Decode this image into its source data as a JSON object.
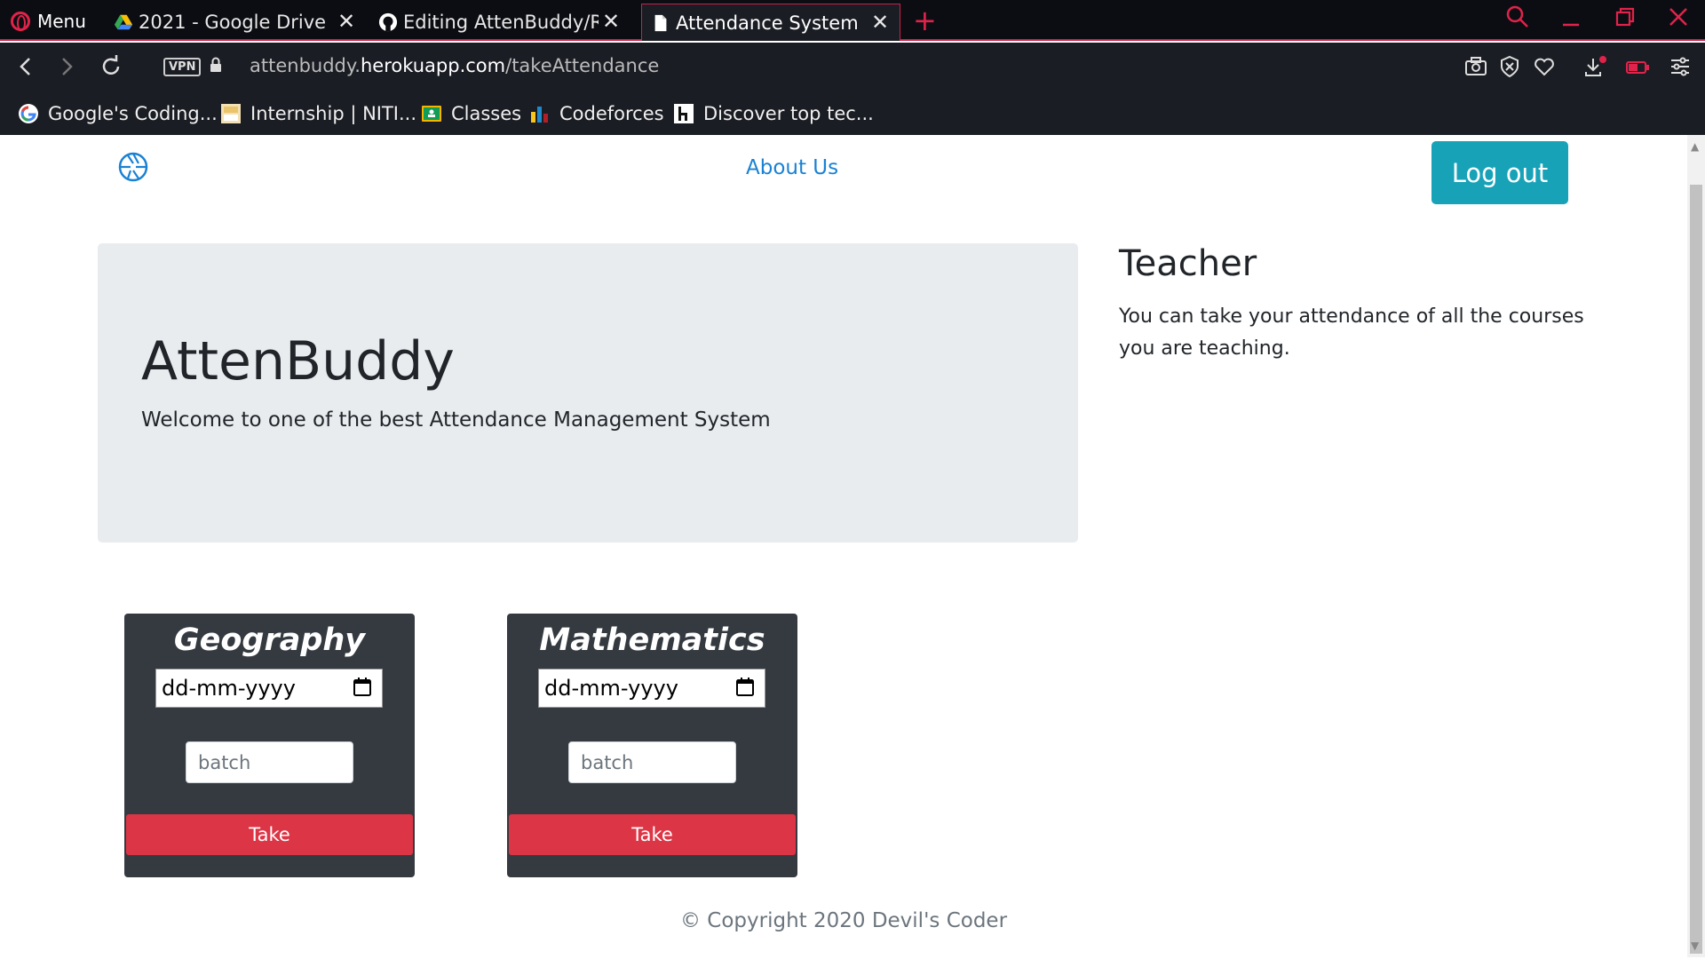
{
  "browser": {
    "menu_label": "Menu",
    "tabs": [
      {
        "title": "2021 - Google Drive"
      },
      {
        "title": "Editing AttenBuddy/README"
      },
      {
        "title": "Attendance System"
      }
    ],
    "vpn_label": "VPN",
    "url_host_prefix": "attenbuddy.",
    "url_host_main": "herokuapp.com",
    "url_path": "/takeAttendance",
    "bookmarks": [
      {
        "label": "Google's Coding..."
      },
      {
        "label": "Internship | NITI..."
      },
      {
        "label": "Classes"
      },
      {
        "label": "Codeforces"
      },
      {
        "label": "Discover top tec..."
      }
    ]
  },
  "nav": {
    "about_label": "About Us",
    "logout_label": "Log out"
  },
  "jumbotron": {
    "title": "AttenBuddy",
    "subtitle": "Welcome to one of the best Attendance Management System"
  },
  "teacher": {
    "title": "Teacher",
    "description": "You can take your attendance of all the courses you are teaching."
  },
  "courses": [
    {
      "name": "Geography",
      "date_placeholder": "dd-mm-yyyy",
      "batch_placeholder": "batch",
      "button_label": "Take"
    },
    {
      "name": "Mathematics",
      "date_placeholder": "dd-mm-yyyy",
      "batch_placeholder": "batch",
      "button_label": "Take"
    }
  ],
  "footer": {
    "text": "© Copyright 2020 Devil's Coder"
  },
  "colors": {
    "accent": "#e0234a",
    "info_button": "#17a2b8",
    "danger_button": "#dc3545",
    "card_bg": "#343a40",
    "jumbotron_bg": "#e9ecef",
    "link": "#1a82d4"
  }
}
